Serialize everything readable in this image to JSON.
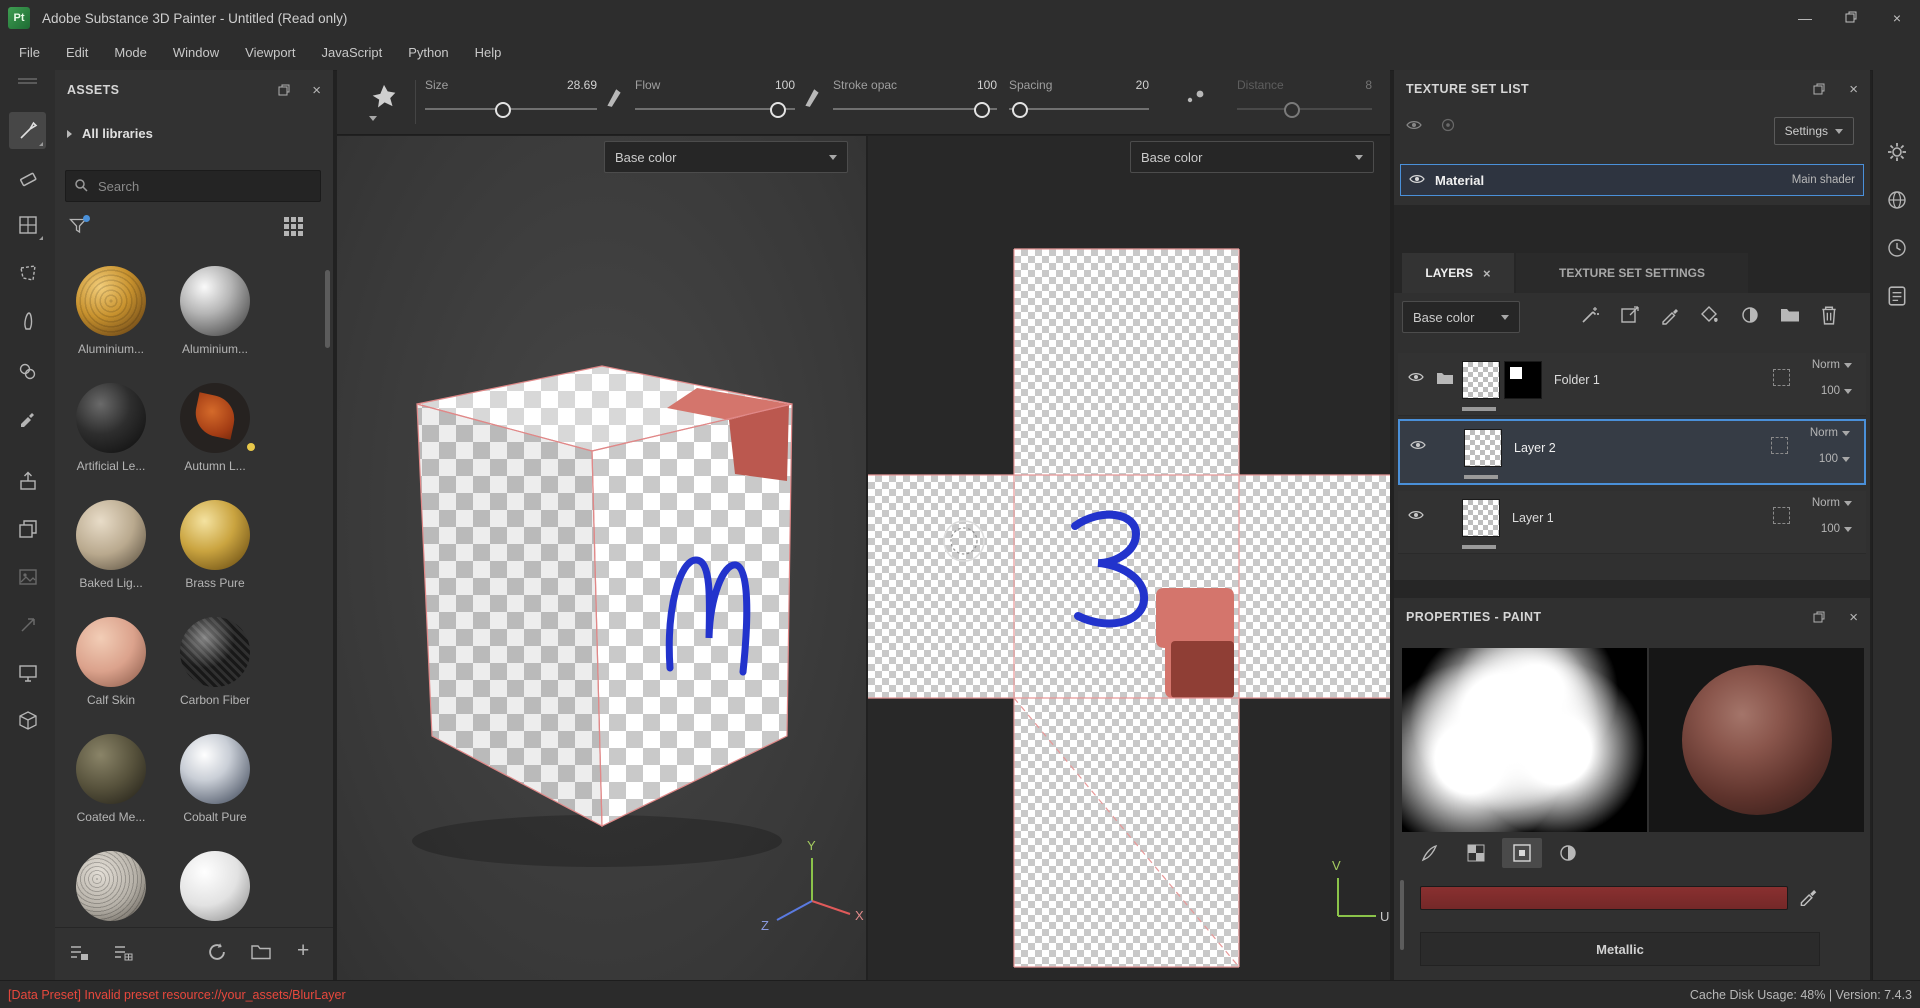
{
  "window": {
    "title": "Adobe Substance 3D Painter - Untitled (Read only)",
    "app_badge": "Pt"
  },
  "icons": {
    "close": "×",
    "minimize": "—",
    "plus": "+"
  },
  "menu": {
    "items": [
      "File",
      "Edit",
      "Mode",
      "Window",
      "Viewport",
      "JavaScript",
      "Python",
      "Help"
    ]
  },
  "toolbar": {
    "sliders": [
      {
        "label": "Size",
        "value": "28.69"
      },
      {
        "label": "Flow",
        "value": "100"
      },
      {
        "label": "Stroke opac",
        "value": "100"
      },
      {
        "label": "Spacing",
        "value": "20"
      },
      {
        "label": "Distance",
        "value": "8"
      }
    ]
  },
  "assets": {
    "title": "ASSETS",
    "library_label": "All libraries",
    "search_placeholder": "Search",
    "items": [
      {
        "label": "Aluminium..."
      },
      {
        "label": "Aluminium..."
      },
      {
        "label": "Artificial Le..."
      },
      {
        "label": "Autumn L..."
      },
      {
        "label": "Baked Lig..."
      },
      {
        "label": "Brass Pure"
      },
      {
        "label": "Calf Skin"
      },
      {
        "label": "Carbon Fiber"
      },
      {
        "label": "Coated Me..."
      },
      {
        "label": "Cobalt Pure"
      },
      {
        "label": ""
      },
      {
        "label": ""
      }
    ]
  },
  "viewport3d": {
    "channel": "Base color",
    "axis_x": "X",
    "axis_y": "Y",
    "axis_z": "Z"
  },
  "viewport2d": {
    "channel": "Base color",
    "axis_u": "U",
    "axis_v": "V"
  },
  "texture_set": {
    "title": "TEXTURE SET LIST",
    "settings_label": "Settings",
    "material_name": "Material",
    "shader_label": "Main shader"
  },
  "layers": {
    "tab_layers": "LAYERS",
    "tab_settings": "TEXTURE SET SETTINGS",
    "channel": "Base color",
    "items": [
      {
        "name": "Folder 1",
        "blend": "Norm",
        "opacity": "100"
      },
      {
        "name": "Layer 2",
        "blend": "Norm",
        "opacity": "100"
      },
      {
        "name": "Layer 1",
        "blend": "Norm",
        "opacity": "100"
      }
    ]
  },
  "properties": {
    "title": "PROPERTIES - PAINT",
    "metallic_label": "Metallic"
  },
  "status": {
    "error": "[Data Preset] Invalid preset resource://your_assets/BlurLayer",
    "info": "Cache Disk Usage:  48% | Version: 7.4.3"
  },
  "colors": {
    "accent": "#4a90d9",
    "error": "#e8483d",
    "paint_stroke": "#2233cc",
    "uv_lines": "#e89898",
    "patch": "#d4756c",
    "patch_dark": "#8f3e35"
  }
}
